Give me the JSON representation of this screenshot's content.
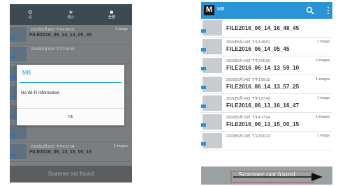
{
  "left": {
    "tabs": [
      {
        "label": "设",
        "icon": "settings-icon"
      },
      {
        "label": "缩火",
        "icon": "star-icon"
      },
      {
        "label": "全部",
        "icon": "grid-icon"
      }
    ],
    "rows": [
      {
        "date": "2016年6月14日 下午4:49:01",
        "count": "1 image",
        "name": "FILE2016_06_14_14_05_45"
      },
      {
        "date": "2016年6月14日 下午2:05:56",
        "count": "",
        "name": ""
      },
      {
        "date": "",
        "count": "",
        "name": ""
      },
      {
        "date": "",
        "count": "",
        "name": ""
      },
      {
        "date": "",
        "count": "",
        "name": ""
      },
      {
        "date": "",
        "count": "",
        "name": ""
      },
      {
        "date": "2016年6月13日 下午4:17:04",
        "count": "2 images",
        "name": "FILE2016_06_13_15_00_15"
      }
    ],
    "dialog": {
      "title": "MB",
      "message": "No Wi-Fi Information.",
      "ok": "Ok"
    },
    "status": "Scanner not found"
  },
  "right": {
    "app_title": "MB",
    "logo_letter": "M",
    "rows": [
      {
        "date": "",
        "count": "",
        "name": "FILE2016_06_14_16_48_45"
      },
      {
        "date": "2016年6月14日 下午4:49:01",
        "count": "1 image",
        "name": "FILE2016_06_14_05_45"
      },
      {
        "date": "2016年6月14日 下午2:05:56",
        "count": "2 images",
        "name": "FILE2016_06_14_13_59_10"
      },
      {
        "date": "2016年6月14日 下午1:59:33",
        "count": "4 images",
        "name": "FILE2016_06_14_13_57_25"
      },
      {
        "date": "2016年6月14日 下午1:57:40",
        "count": "1 image",
        "name": "FILE2016_06_13_16_16_47"
      },
      {
        "date": "2016年6月13日 下午4:17:04",
        "count": "2 images",
        "name": "FILE2016_06_13_15_00_15"
      },
      {
        "date": "2016年6月13日 下午3:00:23",
        "count": "1 image",
        "name": ""
      }
    ],
    "status": "Scanner not found"
  },
  "colors": {
    "accent": "#2c94d6",
    "dialog_accent": "#1a9fd6",
    "tag": "#8b4fb0"
  }
}
